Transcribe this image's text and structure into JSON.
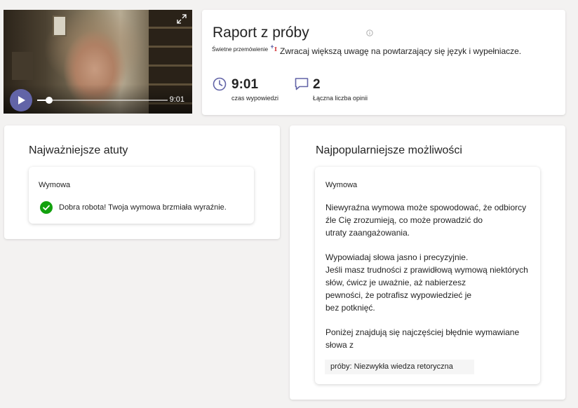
{
  "video": {
    "current_time": "9:01",
    "progress_fraction": 0.09
  },
  "report": {
    "title": "Raport z próby",
    "badge": "Świetne przemówienie",
    "tip": "Zwracaj większą uwagę na powtarzający się język i wypełniacze.",
    "metrics": [
      {
        "icon": "clock-icon",
        "value": "9:01",
        "label": "czas wypowiedzi"
      },
      {
        "icon": "chat-icon",
        "value": "2",
        "label": "Łączna liczba opinii"
      }
    ]
  },
  "strengths": {
    "title": "Najważniejsze atuty",
    "card": {
      "category": "Wymowa",
      "message": "Dobra robota! Twoja wymowa brzmiała wyraźnie."
    }
  },
  "opportunities": {
    "title": "Najpopularniejsze możliwości",
    "card": {
      "category": "Wymowa",
      "paragraph1": [
        "Niewyraźna wymowa może spowodować, że odbiorcy",
        "źle Cię zrozumieją, co może prowadzić do",
        "utraty zaangażowania."
      ],
      "paragraph2": [
        "Wypowiadaj słowa jasno i precyzyjnie.",
        "Jeśli masz trudności z prawidłową wymową niektórych",
        "słów, ćwicz je uważnie, aż nabierzesz",
        "pewności, że potrafisz wypowiedzieć je",
        "bez potknięć."
      ],
      "paragraph3": [
        "Poniżej znajdują się najczęściej błędnie wymawiane",
        "słowa z"
      ],
      "word": "próby: Niezwykła wiedza retoryczna"
    }
  },
  "colors": {
    "accent": "#6264a7",
    "success": "#13a10e",
    "page_bg": "#f3f2f1"
  }
}
